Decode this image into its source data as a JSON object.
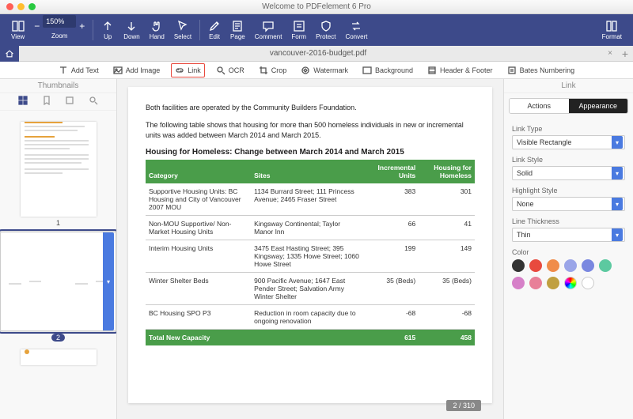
{
  "app": {
    "title": "Welcome to PDFelement 6 Pro"
  },
  "toolbar": {
    "view": "View",
    "zoom": "Zoom",
    "zoom_value": "150%",
    "up": "Up",
    "down": "Down",
    "hand": "Hand",
    "select": "Select",
    "edit": "Edit",
    "page": "Page",
    "comment": "Comment",
    "form": "Form",
    "protect": "Protect",
    "convert": "Convert",
    "format": "Format"
  },
  "document": {
    "filename": "vancouver-2016-budget.pdf"
  },
  "subtoolbar": {
    "add_text": "Add Text",
    "add_image": "Add Image",
    "link": "Link",
    "ocr": "OCR",
    "crop": "Crop",
    "watermark": "Watermark",
    "background": "Background",
    "header_footer": "Header & Footer",
    "bates": "Bates Numbering"
  },
  "sidebar": {
    "title": "Thumbnails",
    "page1_num": "1",
    "page2_num": "2"
  },
  "page": {
    "para1": "Both facilities are operated by the Community Builders Foundation.",
    "para2": "The following table shows that housing for more than 500 homeless individuals in new or incremental units was added between March 2014 and March 2015.",
    "table_title": "Housing for Homeless: Change between March 2014 and March 2015",
    "headers": {
      "category": "Category",
      "sites": "Sites",
      "incremental": "Incremental Units",
      "homeless": "Housing for Homeless"
    }
  },
  "chart_data": {
    "type": "table",
    "title": "Housing for Homeless: Change between March 2014 and March 2015",
    "columns": [
      "Category",
      "Sites",
      "Incremental Units",
      "Housing for Homeless"
    ],
    "rows": [
      {
        "category": "Supportive Housing Units: BC Housing and City of Vancouver 2007 MOU",
        "sites": "1134 Burrard Street; 111 Princess Avenue; 2465 Fraser Street",
        "incremental": "383",
        "homeless": "301"
      },
      {
        "category": "Non-MOU Supportive/ Non-Market Housing Units",
        "sites": "Kingsway Continental; Taylor Manor Inn",
        "incremental": "66",
        "homeless": "41"
      },
      {
        "category": "Interim Housing Units",
        "sites": "3475 East Hasting Street; 395 Kingsway; 1335 Howe Street; 1060 Howe Street",
        "incremental": "199",
        "homeless": "149"
      },
      {
        "category": "Winter Shelter Beds",
        "sites": "900 Pacific Avenue; 1647 East Pender Street; Salvation Army Winter Shelter",
        "incremental": "35 (Beds)",
        "homeless": "35 (Beds)"
      },
      {
        "category": "BC Housing SPO P3",
        "sites": "Reduction in room capacity due to ongoing renovation",
        "incremental": "-68",
        "homeless": "-68"
      }
    ],
    "total": {
      "category": "Total New Capacity",
      "sites": "",
      "incremental": "615",
      "homeless": "458"
    }
  },
  "pagination": {
    "display": "2 / 310"
  },
  "link_panel": {
    "title": "Link",
    "actions": "Actions",
    "appearance": "Appearance",
    "link_type_label": "Link Type",
    "link_type": "Visible Rectangle",
    "link_style_label": "Link Style",
    "link_style": "Solid",
    "highlight_label": "Highlight Style",
    "highlight": "None",
    "thickness_label": "Line Thickness",
    "thickness": "Thin",
    "color_label": "Color",
    "colors": [
      "#333333",
      "#e84a3e",
      "#f08c4a",
      "#9aa5e8",
      "#7a88e0",
      "#5cc9a0",
      "#d680c8",
      "#e88098",
      "#c0a040",
      "#f0f0f0",
      "#ffffff"
    ]
  }
}
